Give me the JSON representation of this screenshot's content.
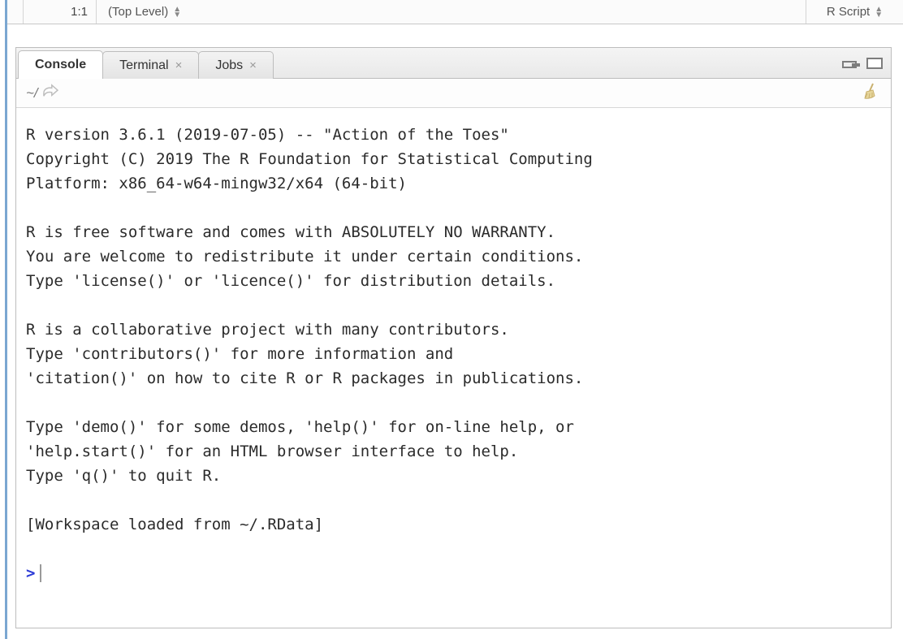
{
  "status": {
    "position": "1:1",
    "scope": "(Top Level)",
    "language": "R Script"
  },
  "tabs": {
    "items": [
      {
        "label": "Console",
        "closable": false,
        "active": true
      },
      {
        "label": "Terminal",
        "closable": true,
        "active": false
      },
      {
        "label": "Jobs",
        "closable": true,
        "active": false
      }
    ]
  },
  "toolbar": {
    "path": "~/"
  },
  "console": {
    "lines": [
      "R version 3.6.1 (2019-07-05) -- \"Action of the Toes\"",
      "Copyright (C) 2019 The R Foundation for Statistical Computing",
      "Platform: x86_64-w64-mingw32/x64 (64-bit)",
      "",
      "R is free software and comes with ABSOLUTELY NO WARRANTY.",
      "You are welcome to redistribute it under certain conditions.",
      "Type 'license()' or 'licence()' for distribution details.",
      "",
      "R is a collaborative project with many contributors.",
      "Type 'contributors()' for more information and",
      "'citation()' on how to cite R or R packages in publications.",
      "",
      "Type 'demo()' for some demos, 'help()' for on-line help, or",
      "'help.start()' for an HTML browser interface to help.",
      "Type 'q()' to quit R.",
      "",
      "[Workspace loaded from ~/.RData]",
      ""
    ],
    "prompt": ">"
  }
}
